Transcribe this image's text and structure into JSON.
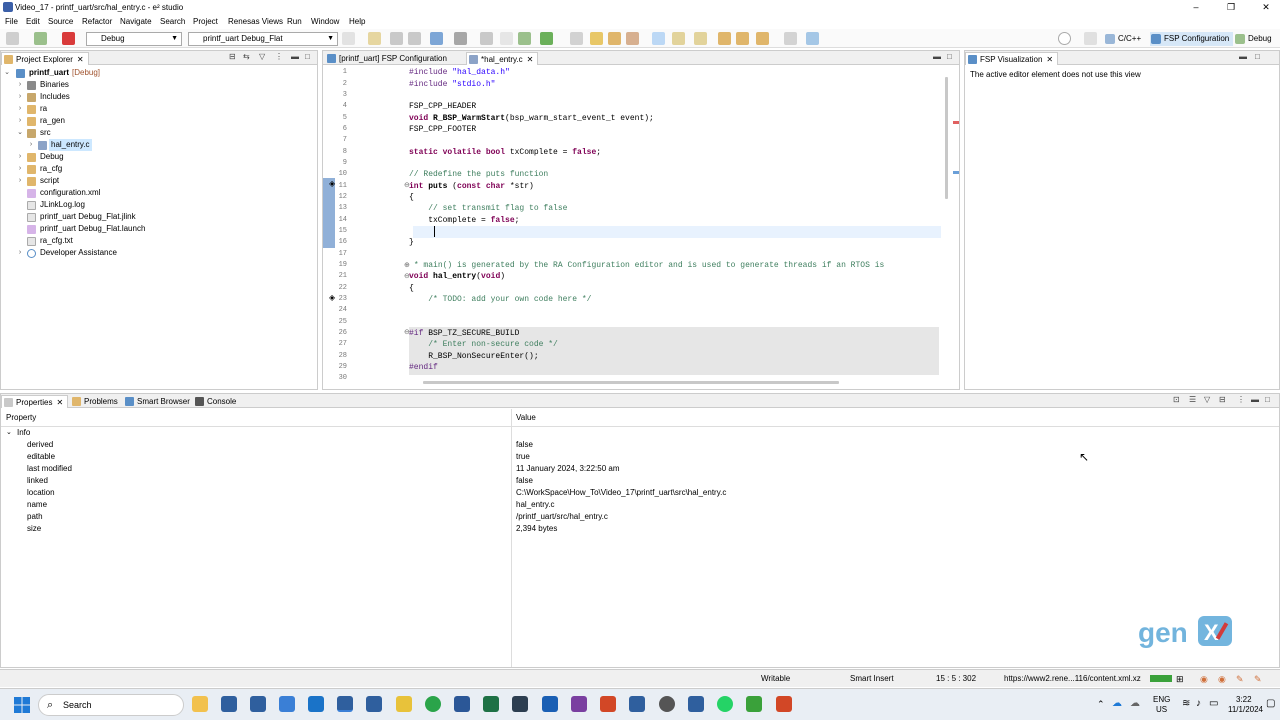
{
  "window": {
    "title": "Video_17 - printf_uart/src/hal_entry.c - e² studio",
    "min": "–",
    "max": "❐",
    "close": "✕"
  },
  "menu": [
    "File",
    "Edit",
    "Source",
    "Refactor",
    "Navigate",
    "Search",
    "Project",
    "Renesas Views",
    "Run",
    "Window",
    "Help"
  ],
  "toolbar": {
    "build_config": "Debug",
    "launch_config": "printf_uart Debug_Flat",
    "perspectives": [
      "C/C++",
      "FSP Configuration",
      "Debug"
    ]
  },
  "project_explorer": {
    "tab_label": "Project Explorer",
    "items": [
      {
        "label": "printf_uart",
        "suffix": "[Debug]"
      },
      {
        "label": "Binaries"
      },
      {
        "label": "Includes"
      },
      {
        "label": "ra"
      },
      {
        "label": "ra_gen"
      },
      {
        "label": "src"
      },
      {
        "label": "hal_entry.c"
      },
      {
        "label": "Debug"
      },
      {
        "label": "ra_cfg"
      },
      {
        "label": "script"
      },
      {
        "label": "configuration.xml"
      },
      {
        "label": "JLinkLog.log"
      },
      {
        "label": "printf_uart Debug_Flat.jlink"
      },
      {
        "label": "printf_uart Debug_Flat.launch"
      },
      {
        "label": "ra_cfg.txt"
      },
      {
        "label": "Developer Assistance"
      }
    ]
  },
  "editor": {
    "tabs": [
      "[printf_uart] FSP Configuration",
      "*hal_entry.c"
    ],
    "line_numbers": [
      "1",
      "2",
      "3",
      "4",
      "5",
      "6",
      "7",
      "8",
      "9",
      "10",
      "11",
      "12",
      "13",
      "14",
      "15",
      "16",
      "17",
      "19",
      "21",
      "22",
      "23",
      "24",
      "25",
      "26",
      "27",
      "28",
      "29",
      "30"
    ]
  },
  "fsp_viz": {
    "tab_label": "FSP Visualization",
    "message": "The active editor element does not use this view"
  },
  "bottom_tabs": [
    "Properties",
    "Problems",
    "Smart Browser",
    "Console"
  ],
  "properties": {
    "col_property": "Property",
    "col_value": "Value",
    "group": "Info",
    "rows": [
      {
        "k": "derived",
        "v": "false"
      },
      {
        "k": "editable",
        "v": "true"
      },
      {
        "k": "last modified",
        "v": "11 January 2024, 3:22:50 am"
      },
      {
        "k": "linked",
        "v": "false"
      },
      {
        "k": "location",
        "v": "C:\\WorkSpace\\How_To\\Video_17\\printf_uart\\src\\hal_entry.c"
      },
      {
        "k": "name",
        "v": "hal_entry.c"
      },
      {
        "k": "path",
        "v": "/printf_uart/src/hal_entry.c"
      },
      {
        "k": "size",
        "v": "2,394  bytes"
      }
    ]
  },
  "status": {
    "writable": "Writable",
    "insert": "Smart Insert",
    "pos": "15 : 5 : 302",
    "url": "https://www2.rene...116/content.xml.xz"
  },
  "taskbar": {
    "search": "Search",
    "lang1": "ENG",
    "lang2": "US",
    "time": "3:22",
    "date": "11/1/2024"
  },
  "logo_text": "genXl"
}
